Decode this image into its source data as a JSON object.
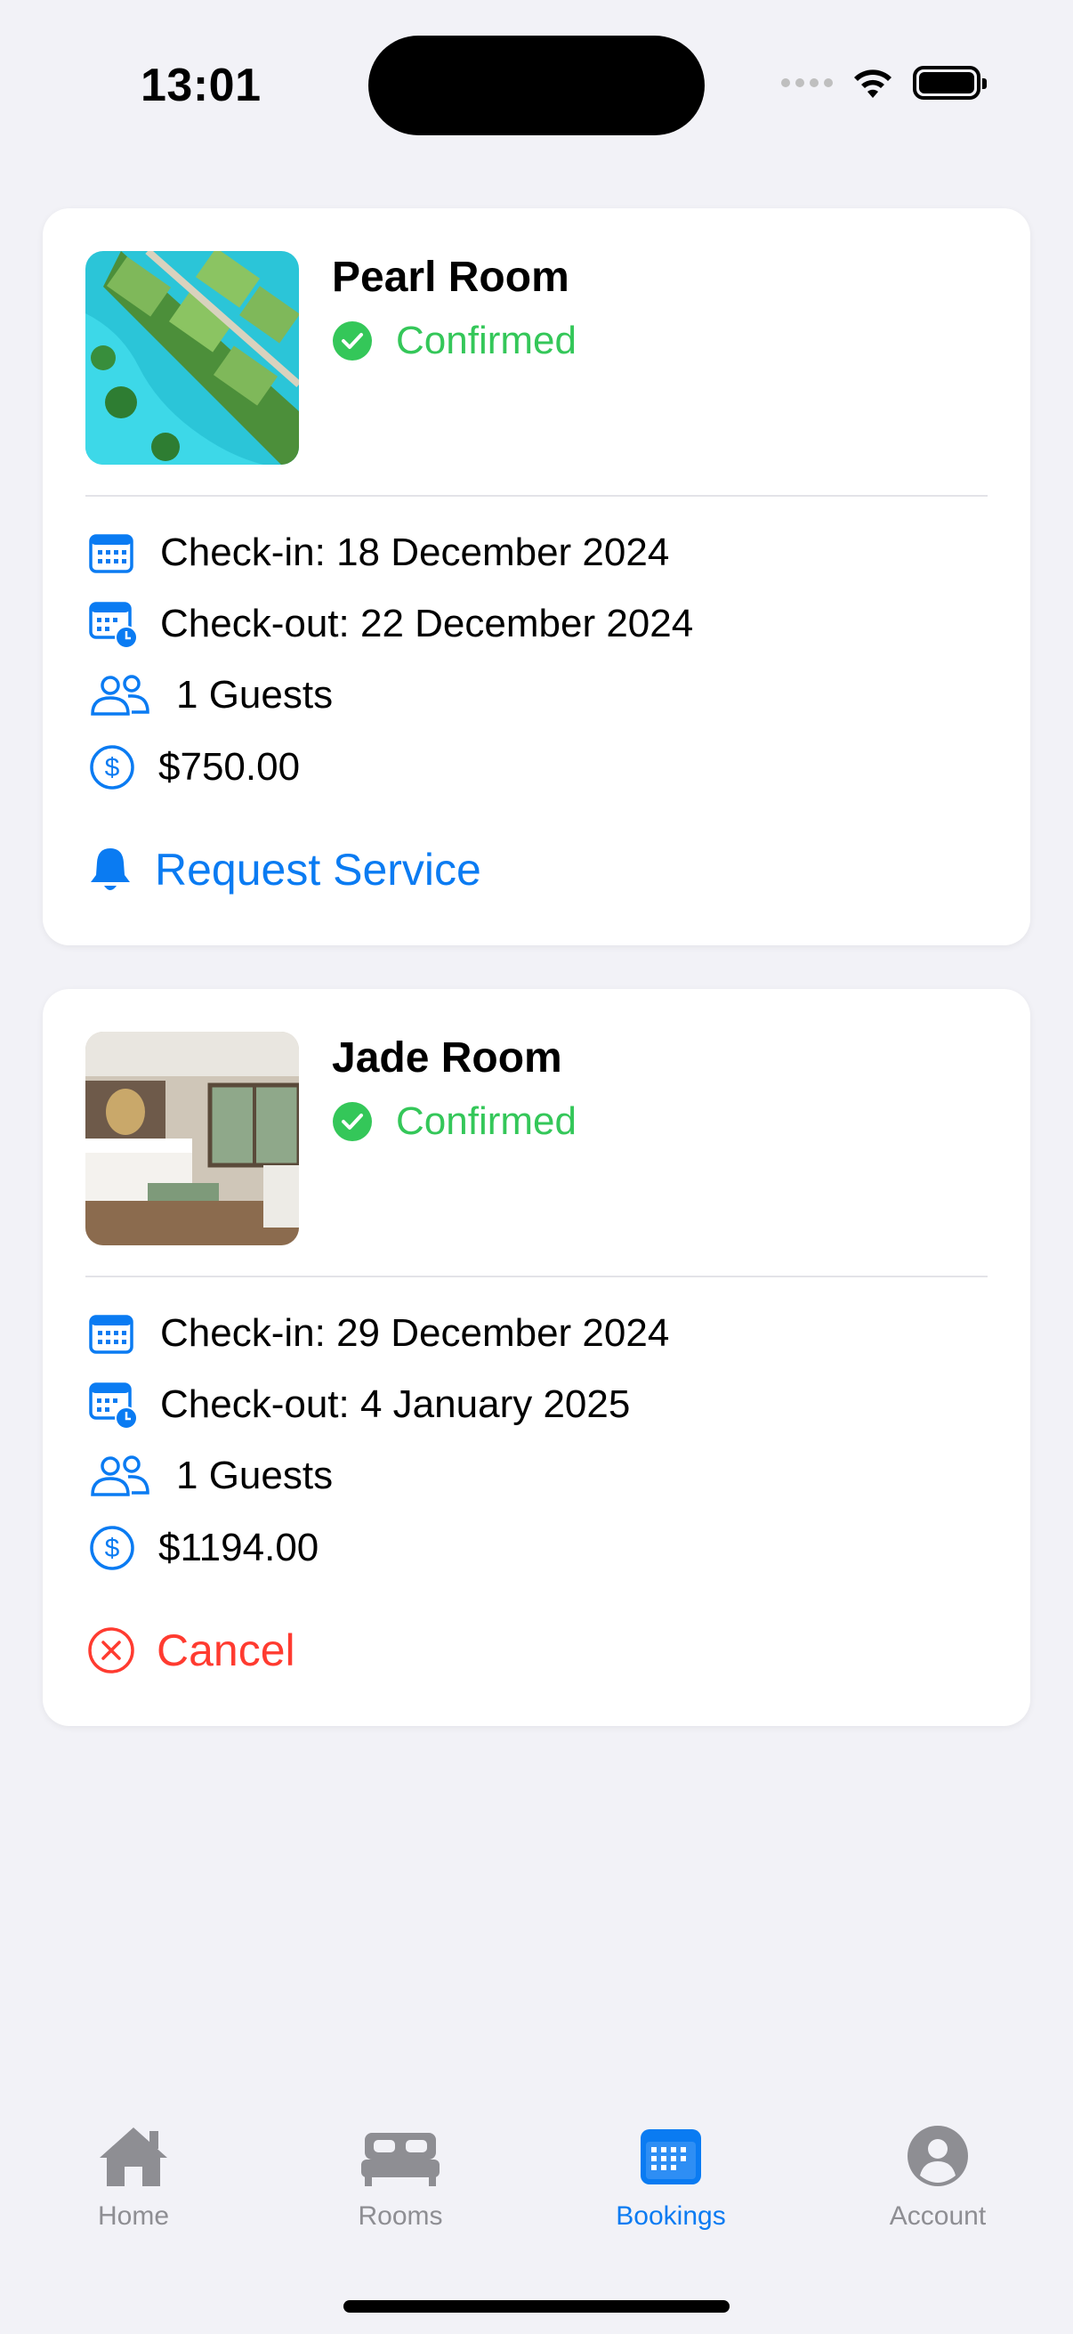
{
  "status_bar": {
    "time": "13:01"
  },
  "bookings": [
    {
      "room_name": "Pearl Room",
      "status": "Confirmed",
      "check_in": "Check-in: 18 December 2024",
      "check_out": "Check-out: 22 December 2024",
      "guests": "1 Guests",
      "price": "$750.00",
      "action_label": "Request Service",
      "action_icon": "bell-icon"
    },
    {
      "room_name": "Jade Room",
      "status": "Confirmed",
      "check_in": "Check-in: 29 December 2024",
      "check_out": "Check-out: 4 January 2025",
      "guests": "1 Guests",
      "price": "$1194.00",
      "action_label": "Cancel",
      "action_icon": "xmark-circle-icon"
    }
  ],
  "tabs": [
    {
      "label": "Home",
      "icon": "house-icon",
      "active": false
    },
    {
      "label": "Rooms",
      "icon": "bed-icon",
      "active": false
    },
    {
      "label": "Bookings",
      "icon": "calendar-icon",
      "active": true
    },
    {
      "label": "Account",
      "icon": "person-circle-icon",
      "active": false
    }
  ],
  "colors": {
    "accent": "#0A7BF2",
    "confirmed": "#34C759",
    "destructive": "#FF3B30",
    "inactive_tab": "#8E8E93",
    "background": "#F2F2F7"
  }
}
